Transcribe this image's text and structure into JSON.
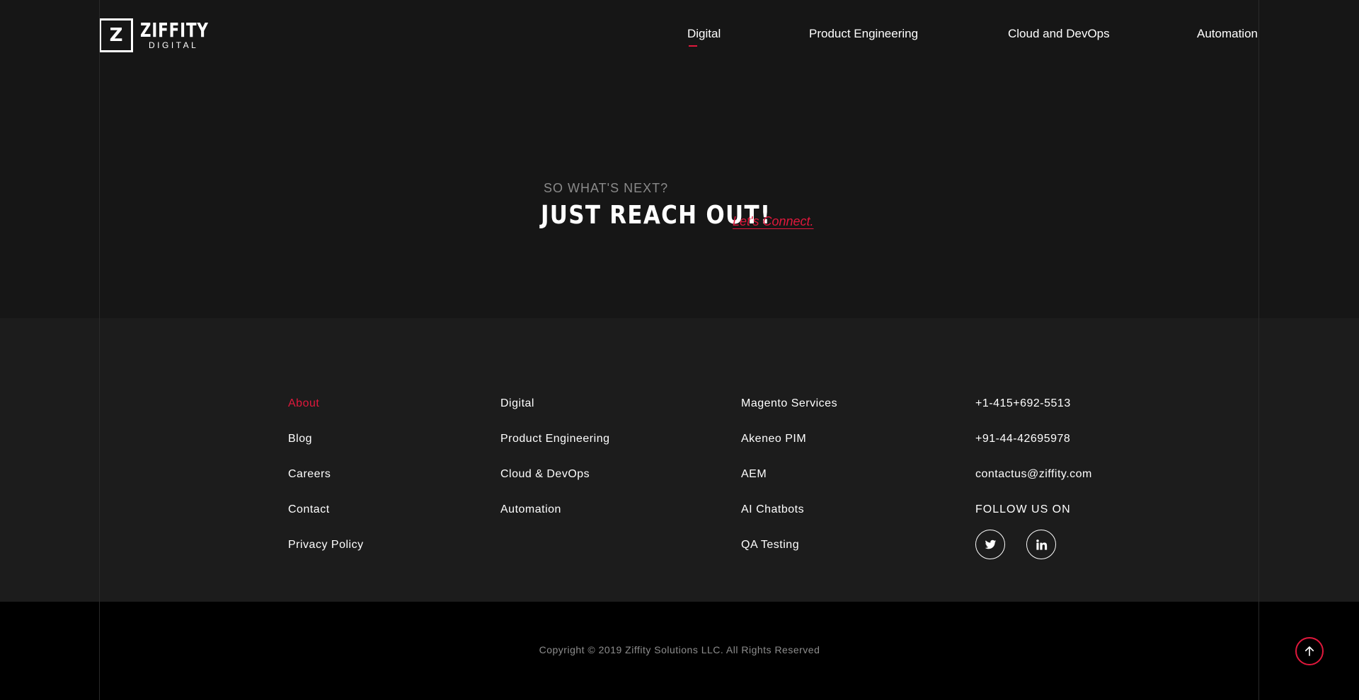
{
  "brand": {
    "name": "ZIFFITY",
    "sub": "DIGITAL",
    "logo_glyph": "Z"
  },
  "nav": {
    "items": [
      {
        "label": "Digital",
        "active": true
      },
      {
        "label": "Product Engineering",
        "active": false
      },
      {
        "label": "Cloud and DevOps",
        "active": false
      },
      {
        "label": "Automation",
        "active": false
      }
    ]
  },
  "cta": {
    "eyebrow": "SO WHAT'S NEXT?",
    "headline": "JUST REACH OUT!",
    "link": "Let's Connect."
  },
  "footer": {
    "company": [
      "About",
      "Blog",
      "Careers",
      "Contact",
      "Privacy Policy"
    ],
    "services": [
      "Digital",
      "Product Engineering",
      "Cloud & DevOps",
      "Automation"
    ],
    "solutions": [
      "Magento Services",
      "Akeneo PIM",
      "AEM",
      "AI Chatbots",
      "QA Testing"
    ],
    "contact": {
      "phone_us": "+1-415+692-5513",
      "phone_in": "+91-44-42695978",
      "email": "contactus@ziffity.com",
      "follow_label": "FOLLOW US ON",
      "socials": [
        "twitter-icon",
        "linkedin-icon"
      ]
    }
  },
  "copyright": "Copyright © 2019 Ziffity Solutions LLC. All Rights Reserved",
  "colors": {
    "accent": "#e0183c",
    "background": "#161616",
    "footer_bg": "#1c1c1c",
    "bottom_bg": "#000000"
  }
}
